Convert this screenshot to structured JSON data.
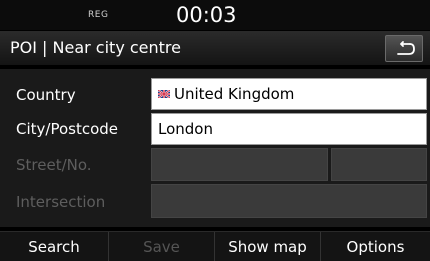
{
  "status": {
    "indicator": "REG",
    "time": "00:03"
  },
  "header": {
    "title": "POI | Near city centre",
    "back_icon": "back-arrow-icon"
  },
  "form": {
    "rows": [
      {
        "label": "Country",
        "value": "United Kingdom",
        "flag_icon": "uk-flag-icon",
        "enabled": true
      },
      {
        "label": "City/Postcode",
        "value": "London",
        "enabled": true
      },
      {
        "label": "Street/No.",
        "value": "",
        "enabled": false
      },
      {
        "label": "Intersection",
        "value": "",
        "enabled": false
      }
    ]
  },
  "bottom": {
    "buttons": [
      {
        "label": "Search",
        "enabled": true
      },
      {
        "label": "Save",
        "enabled": false
      },
      {
        "label": "Show map",
        "enabled": true
      },
      {
        "label": "Options",
        "enabled": true
      }
    ]
  },
  "colors": {
    "background": "#000000",
    "field_active": "#ffffff",
    "field_disabled": "#3a3a3a",
    "text_disabled": "#5e5e5e"
  }
}
